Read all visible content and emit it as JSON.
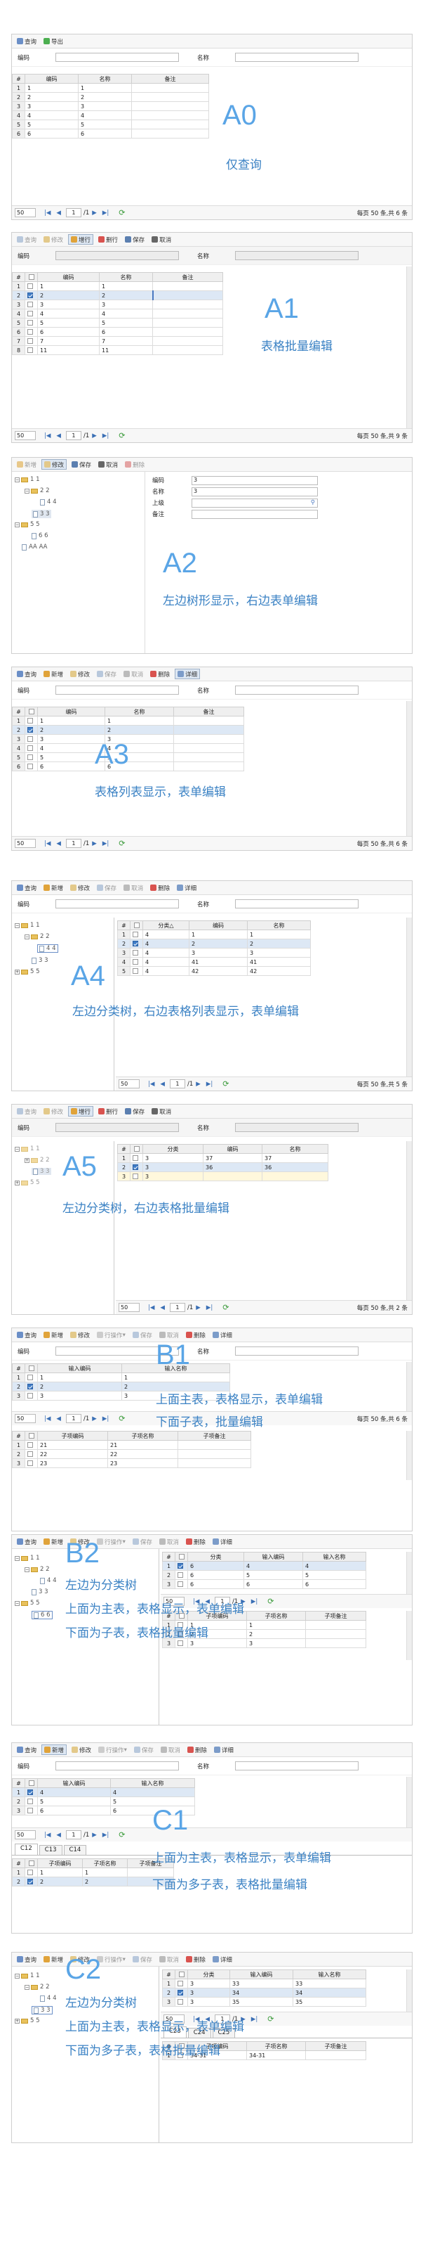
{
  "common": {
    "query": "查询",
    "export": "导出",
    "add": "新增",
    "edit": "修改",
    "addrow": "增行",
    "delrow": "删行",
    "save": "保存",
    "cancel": "取消",
    "delete": "删除",
    "detail": "详细",
    "rowops": "行操作",
    "code_label": "编码",
    "name_label": "名称",
    "parent_label": "上级",
    "remark_label": "备注",
    "pagesize": "50",
    "page": "1",
    "pages": "/1",
    "col_code": "编码",
    "col_name": "名称",
    "col_remark": "备注",
    "col_cat": "分类",
    "col_cat_sort": "分类△",
    "col_incode": "输入编码",
    "col_inname": "输入名称",
    "col_subcode": "子项编码",
    "col_subname": "子项名称",
    "col_subremark": "子项备注"
  },
  "a0": {
    "big": "A0",
    "desc": "仅查询",
    "info": "每页 50 条,共 6 条",
    "rows": [
      [
        "1",
        "1",
        "1"
      ],
      [
        "2",
        "2",
        "2"
      ],
      [
        "3",
        "3",
        "3"
      ],
      [
        "4",
        "4",
        "4"
      ],
      [
        "5",
        "5",
        "5"
      ],
      [
        "6",
        "6",
        "6"
      ]
    ]
  },
  "a1": {
    "big": "A1",
    "desc": "表格批量编辑",
    "info": "每页 50 条,共 9 条",
    "rows": [
      [
        "1",
        "1",
        "1"
      ],
      [
        "2",
        "2",
        "2"
      ],
      [
        "3",
        "3",
        "3"
      ],
      [
        "4",
        "4",
        "4"
      ],
      [
        "5",
        "5",
        "5"
      ],
      [
        "6",
        "6",
        "6"
      ],
      [
        "7",
        "7",
        "7"
      ],
      [
        "8",
        "11",
        "11"
      ]
    ]
  },
  "a2": {
    "big": "A2",
    "desc": "左边树形显示，右边表单编辑",
    "tree": [
      "1 1",
      "2 2",
      "4 4",
      "3 3",
      "5 5",
      "6 6",
      "AA AA"
    ],
    "form": {
      "code": "3",
      "name": "3"
    }
  },
  "a3": {
    "big": "A3",
    "desc": "表格列表显示，表单编辑",
    "info": "每页 50 条,共 6 条",
    "rows": [
      [
        "1",
        "1",
        "1"
      ],
      [
        "2",
        "2",
        "2"
      ],
      [
        "3",
        "3",
        "3"
      ],
      [
        "4",
        "4",
        "4"
      ],
      [
        "5",
        "5",
        "5"
      ],
      [
        "6",
        "6",
        "6"
      ]
    ]
  },
  "a4": {
    "big": "A4",
    "desc": "左边分类树，右边表格列表显示，表单编辑",
    "info": "每页 50 条,共 5 条",
    "tree": [
      "1 1",
      "2 2",
      "4 4",
      "3 3",
      "5 5"
    ],
    "rows": [
      [
        "1",
        "4",
        "1",
        "1"
      ],
      [
        "2",
        "4",
        "2",
        "2"
      ],
      [
        "3",
        "4",
        "3",
        "3"
      ],
      [
        "4",
        "4",
        "41",
        "41"
      ],
      [
        "5",
        "4",
        "42",
        "42"
      ]
    ]
  },
  "a5": {
    "big": "A5",
    "desc": "左边分类树，右边表格批量编辑",
    "info": "每页 50 条,共 2 条",
    "tree": [
      "1 1",
      "2 2",
      "3 3",
      "5 5"
    ],
    "rows": [
      [
        "1",
        "3",
        "37",
        "37"
      ],
      [
        "2",
        "3",
        "36",
        "36"
      ],
      [
        "3",
        "3",
        "",
        ""
      ]
    ]
  },
  "b1": {
    "big": "B1",
    "desc1": "上面主表，表格显示，表单编辑",
    "desc2": "下面子表，批量编辑",
    "info": "每页 50 条,共 6 条",
    "rows": [
      [
        "1",
        "1",
        "1"
      ],
      [
        "2",
        "2",
        "2"
      ],
      [
        "3",
        "3",
        "3"
      ]
    ],
    "sub": [
      [
        "1",
        "21",
        "21"
      ],
      [
        "2",
        "22",
        "22"
      ],
      [
        "3",
        "23",
        "23"
      ]
    ]
  },
  "b2": {
    "big": "B2",
    "desc1": "左边为分类树",
    "desc2": "上面为主表，表格显示，表单编辑",
    "desc3": "下面为子表，表格批量编辑",
    "tree": [
      "1 1",
      "2 2",
      "4 4",
      "3 3",
      "5 5",
      "6 6"
    ],
    "rows": [
      [
        "1",
        "6",
        "4",
        "4"
      ],
      [
        "2",
        "6",
        "5",
        "5"
      ],
      [
        "3",
        "6",
        "6",
        "6"
      ]
    ],
    "sub": [
      [
        "1",
        "1",
        "1"
      ],
      [
        "2",
        "2",
        "2"
      ],
      [
        "3",
        "3",
        "3"
      ]
    ]
  },
  "c1": {
    "big": "C1",
    "desc1": "上面为主表，表格显示，表单编辑",
    "desc2": "下面为多子表，表格批量编辑",
    "tabs": [
      "C12",
      "C13",
      "C14"
    ],
    "rows": [
      [
        "1",
        "4",
        "4"
      ],
      [
        "2",
        "5",
        "5"
      ],
      [
        "3",
        "6",
        "6"
      ]
    ],
    "sub": [
      [
        "1",
        "1",
        "1"
      ],
      [
        "2",
        "2",
        "2"
      ]
    ]
  },
  "c2": {
    "big": "C2",
    "desc1": "左边为分类树",
    "desc2": "上面为主表，表格显示，表单编辑",
    "desc3": "下面为多子表，表格批量编辑",
    "tabs": [
      "C23",
      "C24",
      "C25"
    ],
    "tree": [
      "1 1",
      "2 2",
      "4 4",
      "3 3",
      "5 5"
    ],
    "rows": [
      [
        "1",
        "3",
        "33",
        "33"
      ],
      [
        "2",
        "3",
        "34",
        "34"
      ],
      [
        "3",
        "3",
        "35",
        "35"
      ]
    ],
    "sub": [
      [
        "1",
        "34-31",
        "34-31"
      ]
    ]
  }
}
